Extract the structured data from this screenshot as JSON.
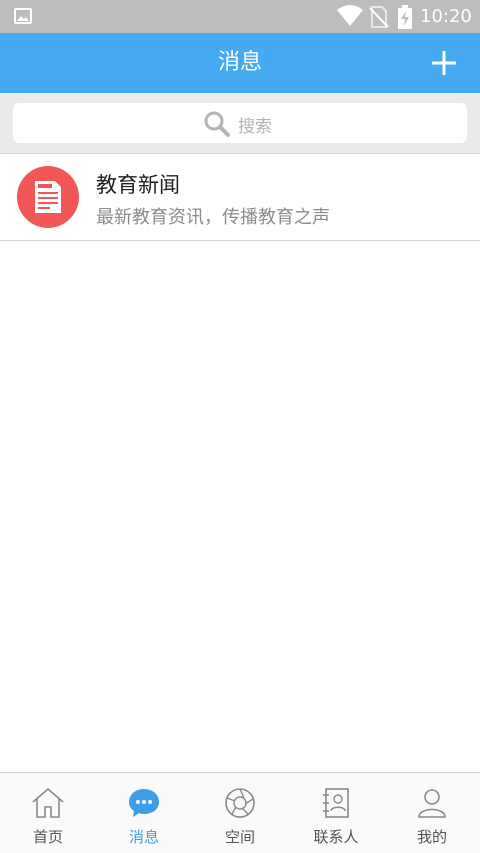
{
  "status_bar": {
    "time": "10:20",
    "icons": [
      "gallery-icon",
      "wifi-icon",
      "no-sim-icon",
      "battery-charging-icon"
    ]
  },
  "header": {
    "title": "消息",
    "add_icon": "plus-icon"
  },
  "search": {
    "placeholder": "搜索",
    "icon": "search-icon"
  },
  "messages": [
    {
      "title": "教育新闻",
      "subtitle": "最新教育资讯，传播教育之声",
      "icon": "news-icon",
      "icon_bg": "#f15757"
    }
  ],
  "tabs": [
    {
      "label": "首页",
      "icon": "home-icon",
      "active": false
    },
    {
      "label": "消息",
      "icon": "chat-icon",
      "active": true
    },
    {
      "label": "空间",
      "icon": "aperture-icon",
      "active": false
    },
    {
      "label": "联系人",
      "icon": "contacts-icon",
      "active": false
    },
    {
      "label": "我的",
      "icon": "person-icon",
      "active": false
    }
  ],
  "colors": {
    "header": "#45aaf1",
    "active_tab": "#3d9de8",
    "status_bar": "#bdbdbd"
  }
}
